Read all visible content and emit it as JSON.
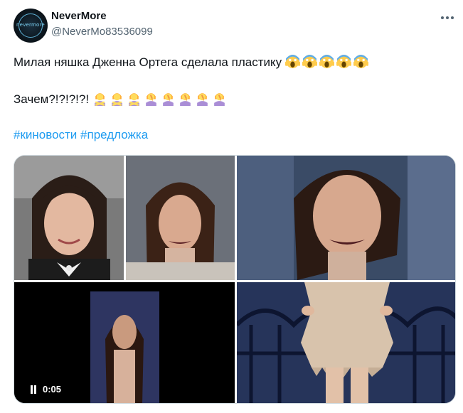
{
  "author": {
    "name": "NeverMore",
    "handle": "@NeverMo83536099",
    "avatar_text": "nevermore"
  },
  "tweet": {
    "line1": "Милая няшка Дженна Ортега сделала пластику",
    "line1_emojis": [
      "screaming-face",
      "screaming-face",
      "screaming-face",
      "screaming-face",
      "screaming-face"
    ],
    "line2": "Зачем?!?!?!?!",
    "line2_emojis": [
      "person-gesturing-no",
      "person-gesturing-no",
      "person-gesturing-no",
      "person-facepalming",
      "person-facepalming",
      "person-facepalming",
      "person-facepalming",
      "person-facepalming"
    ],
    "hashtags": [
      "#киновости",
      "#предложка"
    ]
  },
  "media": {
    "video_duration": "0:05"
  },
  "colors": {
    "accent": "#1d9bf0",
    "text": "#0f1419",
    "secondary": "#536471",
    "border": "#cfd9de"
  }
}
